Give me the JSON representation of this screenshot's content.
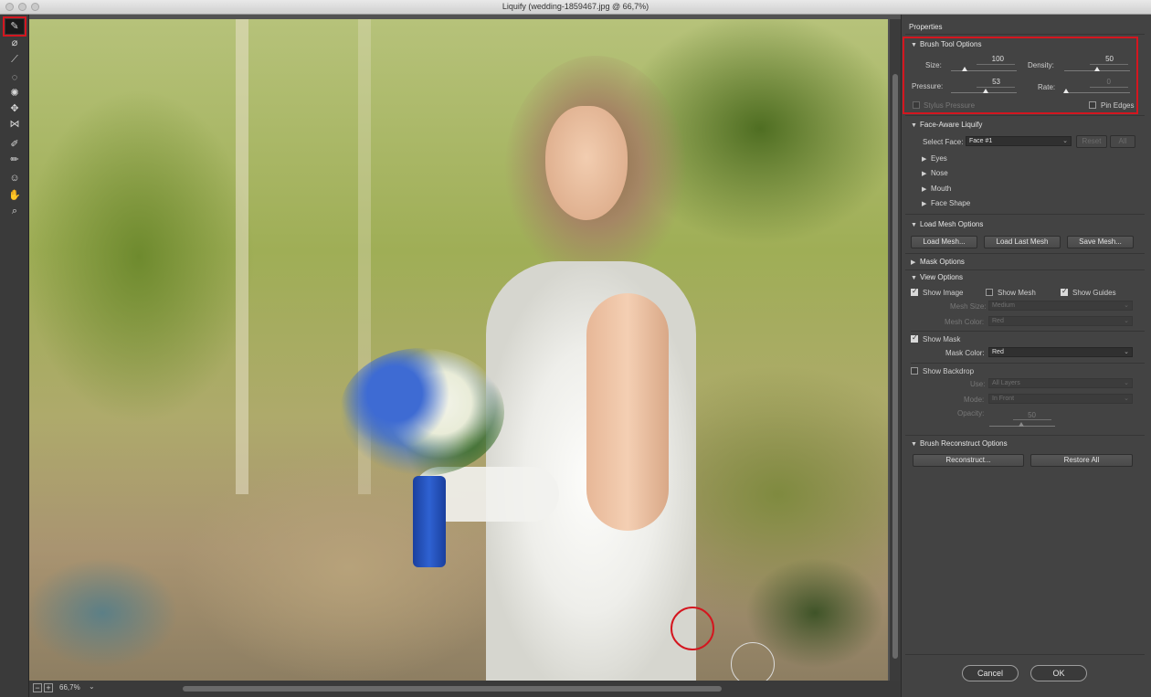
{
  "window": {
    "title": "Liquify (wedding-1859467.jpg @ 66,7%)"
  },
  "toolbar": {
    "tools": [
      "forward-warp",
      "reconstruct",
      "smooth",
      "twirl",
      "pucker",
      "bloat",
      "push-left",
      "freeze-mask",
      "thaw-mask",
      "face",
      "hand",
      "zoom"
    ]
  },
  "canvas": {
    "zoom": "66,7%"
  },
  "panel": {
    "title": "Properties",
    "brush": {
      "header": "Brush Tool Options",
      "size_label": "Size:",
      "size_value": "100",
      "density_label": "Density:",
      "density_value": "50",
      "pressure_label": "Pressure:",
      "pressure_value": "53",
      "rate_label": "Rate:",
      "rate_value": "0",
      "stylus_label": "Stylus Pressure",
      "pin_edges_label": "Pin Edges"
    },
    "face": {
      "header": "Face-Aware Liquify",
      "select_face_label": "Select Face:",
      "select_face_value": "Face #1",
      "reset_label": "Reset",
      "all_label": "All",
      "items": [
        "Eyes",
        "Nose",
        "Mouth",
        "Face Shape"
      ]
    },
    "mesh": {
      "header": "Load Mesh Options",
      "load_mesh": "Load Mesh...",
      "load_last": "Load Last Mesh",
      "save_mesh": "Save Mesh..."
    },
    "mask": {
      "header": "Mask Options"
    },
    "view": {
      "header": "View Options",
      "show_image": "Show Image",
      "show_mesh": "Show Mesh",
      "show_guides": "Show Guides",
      "mesh_size_label": "Mesh Size:",
      "mesh_size_value": "Medium",
      "mesh_color_label": "Mesh Color:",
      "mesh_color_value": "Red",
      "show_mask": "Show Mask",
      "mask_color_label": "Mask Color:",
      "mask_color_value": "Red",
      "show_backdrop": "Show Backdrop",
      "use_label": "Use:",
      "use_value": "All Layers",
      "mode_label": "Mode:",
      "mode_value": "In Front",
      "opacity_label": "Opacity:",
      "opacity_value": "50"
    },
    "reconstruct": {
      "header": "Brush Reconstruct Options",
      "reconstruct_btn": "Reconstruct...",
      "restore_all_btn": "Restore All"
    }
  },
  "footer": {
    "cancel": "Cancel",
    "ok": "OK"
  },
  "colors": {
    "annotation": "#d4161f",
    "panel_bg": "#434343",
    "toolbar_bg": "#3a3a3a"
  },
  "states": {
    "show_image": true,
    "show_mesh": false,
    "show_guides": true,
    "show_mask": true,
    "show_backdrop": false,
    "stylus_pressure": false,
    "pin_edges": false
  }
}
